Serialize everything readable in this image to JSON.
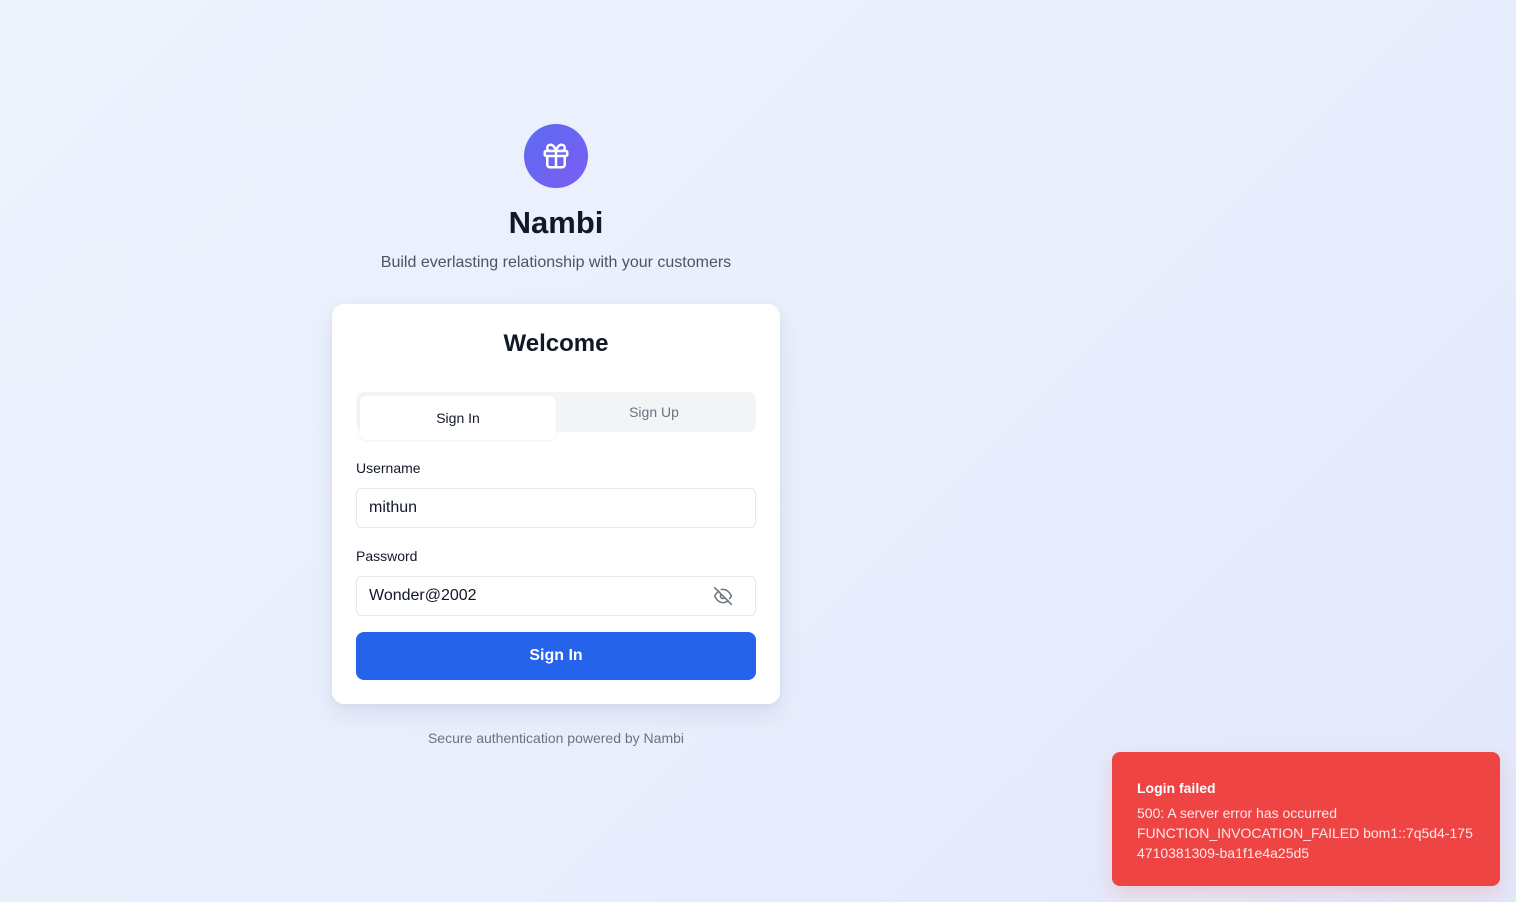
{
  "brand": {
    "logo_icon": "gift-icon",
    "name": "Nambi",
    "tagline": "Build everlasting relationship with your customers",
    "logo_gradient": [
      "#5b6cf2",
      "#7c5cf3"
    ]
  },
  "card": {
    "title": "Welcome",
    "tabs": [
      {
        "label": "Sign In",
        "active": true
      },
      {
        "label": "Sign Up",
        "active": false
      }
    ],
    "username": {
      "label": "Username",
      "value": "mithun"
    },
    "password": {
      "label": "Password",
      "value": "Wonder@2002",
      "toggle_icon": "eye-off-icon"
    },
    "submit_label": "Sign In"
  },
  "footer": {
    "note": "Secure authentication powered by Nambi"
  },
  "toast": {
    "title": "Login failed",
    "line1": "500: A server error has occurred",
    "line2": "FUNCTION_INVOCATION_FAILED bom1::7q5d4-1754710381309-ba1f1e4a25d5",
    "color": "#ef4444"
  },
  "colors": {
    "primary": "#2563eb",
    "error": "#ef4444"
  }
}
